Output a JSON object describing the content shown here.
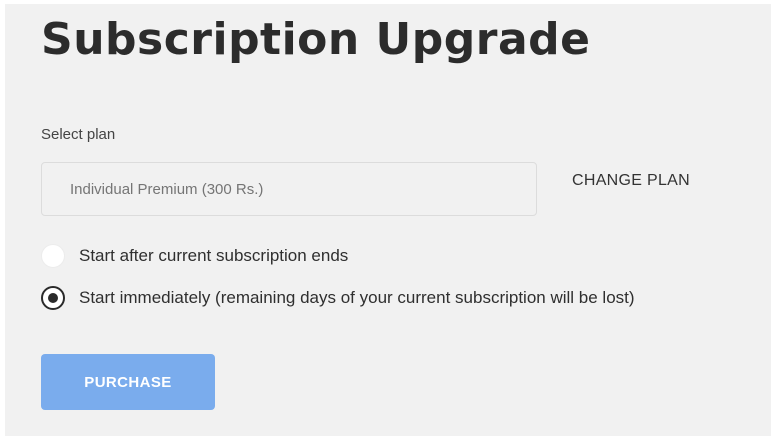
{
  "page": {
    "title": "Subscription Upgrade"
  },
  "plan": {
    "label": "Select plan",
    "placeholder": "Individual Premium (300 Rs.)",
    "value": "",
    "change_label": "CHANGE PLAN"
  },
  "start_options": [
    {
      "label": "Start after current subscription ends",
      "selected": false
    },
    {
      "label": "Start immediately (remaining days of your current subscription will be lost)",
      "selected": true
    }
  ],
  "actions": {
    "purchase_label": "PURCHASE"
  },
  "colors": {
    "background": "#f1f1f1",
    "button": "#7aaced",
    "title": "#2c2c2c",
    "placeholder": "#a9a9a9"
  }
}
